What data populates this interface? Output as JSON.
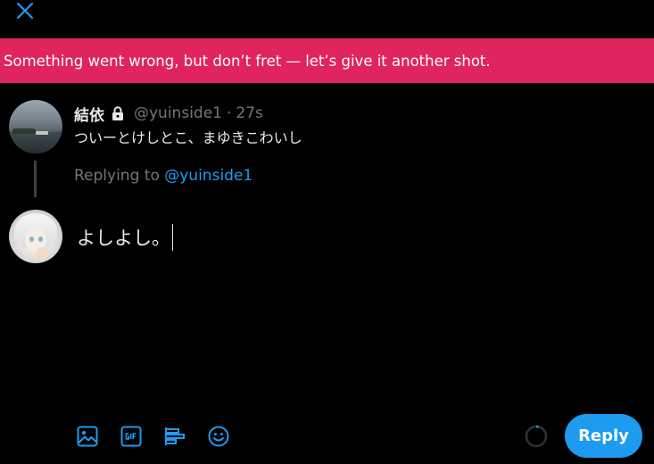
{
  "colors": {
    "background": "#000000",
    "banner_bg": "#e0245e",
    "accent": "#1d9bf0",
    "muted": "#71767b",
    "text": "#e7e9ea"
  },
  "header": {
    "close_icon": "close-icon"
  },
  "error_banner": {
    "message": "Something went wrong, but don’t fret — let’s give it another shot."
  },
  "original_tweet": {
    "display_name": "結依",
    "protected_icon": "lock-icon",
    "handle": "@yuinside1",
    "separator": "·",
    "time": "27s",
    "text": "ついーとけしとこ、まゆきこわいし"
  },
  "reply_context": {
    "prefix": "Replying to ",
    "handle": "@yuinside1"
  },
  "composer": {
    "text": "よしよし。"
  },
  "toolbar": {
    "icons": [
      "media-icon",
      "gif-icon",
      "poll-icon",
      "emoji-icon"
    ],
    "reply_label": "Reply",
    "progress_icon": "char-count-ring-icon"
  }
}
